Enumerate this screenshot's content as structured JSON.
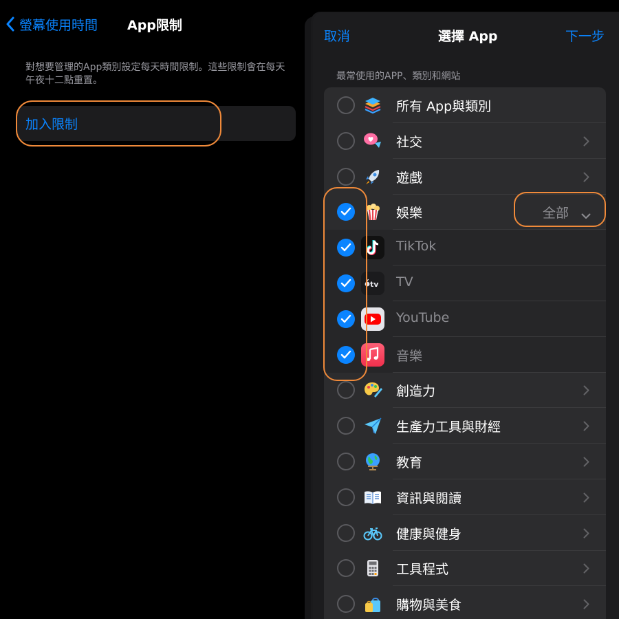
{
  "left": {
    "back_label": "螢幕使用時間",
    "title": "App限制",
    "description": "對想要管理的App類別設定每天時間限制。這些限制會在每天午夜十二點重置。",
    "add_label": "加入限制"
  },
  "sheet": {
    "cancel": "取消",
    "title": "選擇 App",
    "next": "下一步",
    "section": "最常使用的APP、類別和網站",
    "all_label": "全部"
  },
  "rows": [
    {
      "label": "所有 App與類別",
      "icon": "stack-icon",
      "checked": false,
      "sub": false,
      "chevron": false
    },
    {
      "label": "社交",
      "icon": "social-bubble-icon",
      "checked": false,
      "sub": false,
      "chevron": true
    },
    {
      "label": "遊戲",
      "icon": "rocket-icon",
      "checked": false,
      "sub": false,
      "chevron": true
    },
    {
      "label": "娛樂",
      "icon": "popcorn-icon",
      "checked": true,
      "sub": false,
      "chevron": false
    },
    {
      "label": "TikTok",
      "icon": "tiktok-icon",
      "checked": true,
      "sub": true,
      "chevron": false
    },
    {
      "label": "TV",
      "icon": "appletv-icon",
      "checked": true,
      "sub": true,
      "chevron": false
    },
    {
      "label": "YouTube",
      "icon": "youtube-icon",
      "checked": true,
      "sub": true,
      "chevron": false
    },
    {
      "label": "音樂",
      "icon": "music-icon",
      "checked": true,
      "sub": true,
      "chevron": false
    },
    {
      "label": "創造力",
      "icon": "palette-icon",
      "checked": false,
      "sub": false,
      "chevron": true
    },
    {
      "label": "生產力工具與財經",
      "icon": "paper-plane-icon",
      "checked": false,
      "sub": false,
      "chevron": true
    },
    {
      "label": "教育",
      "icon": "globe-icon",
      "checked": false,
      "sub": false,
      "chevron": true
    },
    {
      "label": "資訊與閱讀",
      "icon": "book-icon",
      "checked": false,
      "sub": false,
      "chevron": true
    },
    {
      "label": "健康與健身",
      "icon": "bicycle-icon",
      "checked": false,
      "sub": false,
      "chevron": true
    },
    {
      "label": "工具程式",
      "icon": "calculator-icon",
      "checked": false,
      "sub": false,
      "chevron": true
    },
    {
      "label": "購物與美食",
      "icon": "shopping-bag-icon",
      "checked": false,
      "sub": false,
      "chevron": true
    }
  ],
  "colors": {
    "accent": "#0a84ff",
    "annotation": "#f08a3a"
  }
}
